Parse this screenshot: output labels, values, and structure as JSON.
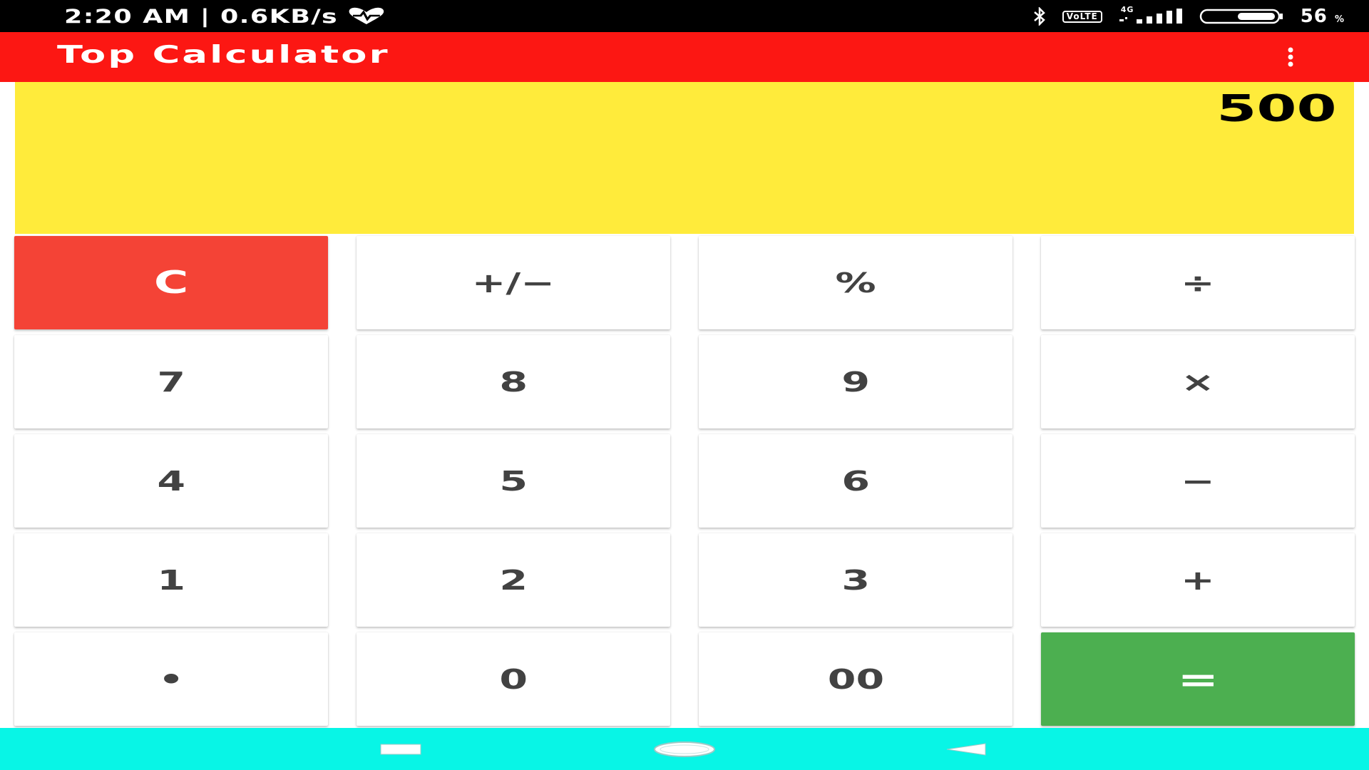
{
  "status_bar": {
    "time": "2:20 AM",
    "separator": "|",
    "network_speed": "0.6KB/s",
    "volte_line1": "Vo",
    "volte_line2": "LTE",
    "network_type": "4G",
    "battery_percent": "56",
    "battery_unit": "%",
    "icons": [
      "heart-monitor-icon",
      "bluetooth-icon",
      "volte-icon",
      "signal-icon",
      "battery-icon"
    ]
  },
  "app_bar": {
    "title": "Top Calculator",
    "menu_icon": "overflow-menu-icon"
  },
  "display": {
    "value": "500"
  },
  "keypad": {
    "keys": [
      "C",
      "+/−",
      "%",
      "÷",
      "7",
      "8",
      "9",
      "×",
      "4",
      "5",
      "6",
      "−",
      "1",
      "2",
      "3",
      "+",
      "•",
      "0",
      "00",
      "="
    ]
  },
  "nav_bar": {
    "icons": [
      "recent-apps-icon",
      "home-icon",
      "back-icon"
    ]
  },
  "colors": {
    "status_bar": "#000000",
    "app_bar": "#fc1713",
    "display": "#ffeb3b",
    "clear_key": "#f44336",
    "equals_key": "#4caf50",
    "key": "#ffffff",
    "key_text": "#424242",
    "nav_bar": "#08f5e6"
  }
}
